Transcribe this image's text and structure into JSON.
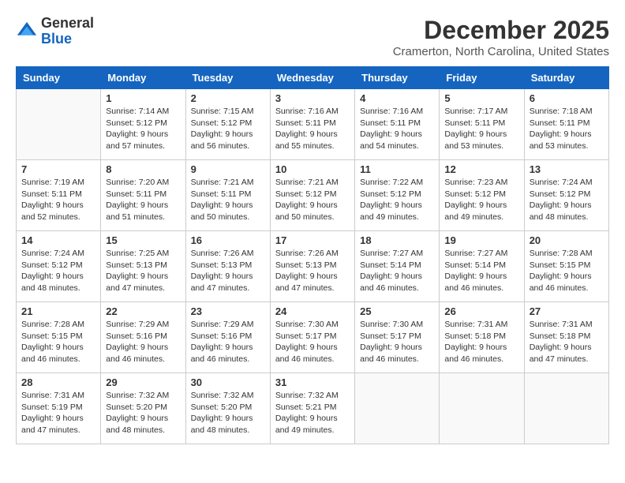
{
  "header": {
    "logo_general": "General",
    "logo_blue": "Blue",
    "month": "December 2025",
    "location": "Cramerton, North Carolina, United States"
  },
  "days_of_week": [
    "Sunday",
    "Monday",
    "Tuesday",
    "Wednesday",
    "Thursday",
    "Friday",
    "Saturday"
  ],
  "weeks": [
    [
      {
        "day": "",
        "info": ""
      },
      {
        "day": "1",
        "info": "Sunrise: 7:14 AM\nSunset: 5:12 PM\nDaylight: 9 hours\nand 57 minutes."
      },
      {
        "day": "2",
        "info": "Sunrise: 7:15 AM\nSunset: 5:12 PM\nDaylight: 9 hours\nand 56 minutes."
      },
      {
        "day": "3",
        "info": "Sunrise: 7:16 AM\nSunset: 5:11 PM\nDaylight: 9 hours\nand 55 minutes."
      },
      {
        "day": "4",
        "info": "Sunrise: 7:16 AM\nSunset: 5:11 PM\nDaylight: 9 hours\nand 54 minutes."
      },
      {
        "day": "5",
        "info": "Sunrise: 7:17 AM\nSunset: 5:11 PM\nDaylight: 9 hours\nand 53 minutes."
      },
      {
        "day": "6",
        "info": "Sunrise: 7:18 AM\nSunset: 5:11 PM\nDaylight: 9 hours\nand 53 minutes."
      }
    ],
    [
      {
        "day": "7",
        "info": "Sunrise: 7:19 AM\nSunset: 5:11 PM\nDaylight: 9 hours\nand 52 minutes."
      },
      {
        "day": "8",
        "info": "Sunrise: 7:20 AM\nSunset: 5:11 PM\nDaylight: 9 hours\nand 51 minutes."
      },
      {
        "day": "9",
        "info": "Sunrise: 7:21 AM\nSunset: 5:11 PM\nDaylight: 9 hours\nand 50 minutes."
      },
      {
        "day": "10",
        "info": "Sunrise: 7:21 AM\nSunset: 5:12 PM\nDaylight: 9 hours\nand 50 minutes."
      },
      {
        "day": "11",
        "info": "Sunrise: 7:22 AM\nSunset: 5:12 PM\nDaylight: 9 hours\nand 49 minutes."
      },
      {
        "day": "12",
        "info": "Sunrise: 7:23 AM\nSunset: 5:12 PM\nDaylight: 9 hours\nand 49 minutes."
      },
      {
        "day": "13",
        "info": "Sunrise: 7:24 AM\nSunset: 5:12 PM\nDaylight: 9 hours\nand 48 minutes."
      }
    ],
    [
      {
        "day": "14",
        "info": "Sunrise: 7:24 AM\nSunset: 5:12 PM\nDaylight: 9 hours\nand 48 minutes."
      },
      {
        "day": "15",
        "info": "Sunrise: 7:25 AM\nSunset: 5:13 PM\nDaylight: 9 hours\nand 47 minutes."
      },
      {
        "day": "16",
        "info": "Sunrise: 7:26 AM\nSunset: 5:13 PM\nDaylight: 9 hours\nand 47 minutes."
      },
      {
        "day": "17",
        "info": "Sunrise: 7:26 AM\nSunset: 5:13 PM\nDaylight: 9 hours\nand 47 minutes."
      },
      {
        "day": "18",
        "info": "Sunrise: 7:27 AM\nSunset: 5:14 PM\nDaylight: 9 hours\nand 46 minutes."
      },
      {
        "day": "19",
        "info": "Sunrise: 7:27 AM\nSunset: 5:14 PM\nDaylight: 9 hours\nand 46 minutes."
      },
      {
        "day": "20",
        "info": "Sunrise: 7:28 AM\nSunset: 5:15 PM\nDaylight: 9 hours\nand 46 minutes."
      }
    ],
    [
      {
        "day": "21",
        "info": "Sunrise: 7:28 AM\nSunset: 5:15 PM\nDaylight: 9 hours\nand 46 minutes."
      },
      {
        "day": "22",
        "info": "Sunrise: 7:29 AM\nSunset: 5:16 PM\nDaylight: 9 hours\nand 46 minutes."
      },
      {
        "day": "23",
        "info": "Sunrise: 7:29 AM\nSunset: 5:16 PM\nDaylight: 9 hours\nand 46 minutes."
      },
      {
        "day": "24",
        "info": "Sunrise: 7:30 AM\nSunset: 5:17 PM\nDaylight: 9 hours\nand 46 minutes."
      },
      {
        "day": "25",
        "info": "Sunrise: 7:30 AM\nSunset: 5:17 PM\nDaylight: 9 hours\nand 46 minutes."
      },
      {
        "day": "26",
        "info": "Sunrise: 7:31 AM\nSunset: 5:18 PM\nDaylight: 9 hours\nand 46 minutes."
      },
      {
        "day": "27",
        "info": "Sunrise: 7:31 AM\nSunset: 5:18 PM\nDaylight: 9 hours\nand 47 minutes."
      }
    ],
    [
      {
        "day": "28",
        "info": "Sunrise: 7:31 AM\nSunset: 5:19 PM\nDaylight: 9 hours\nand 47 minutes."
      },
      {
        "day": "29",
        "info": "Sunrise: 7:32 AM\nSunset: 5:20 PM\nDaylight: 9 hours\nand 48 minutes."
      },
      {
        "day": "30",
        "info": "Sunrise: 7:32 AM\nSunset: 5:20 PM\nDaylight: 9 hours\nand 48 minutes."
      },
      {
        "day": "31",
        "info": "Sunrise: 7:32 AM\nSunset: 5:21 PM\nDaylight: 9 hours\nand 49 minutes."
      },
      {
        "day": "",
        "info": ""
      },
      {
        "day": "",
        "info": ""
      },
      {
        "day": "",
        "info": ""
      }
    ]
  ]
}
